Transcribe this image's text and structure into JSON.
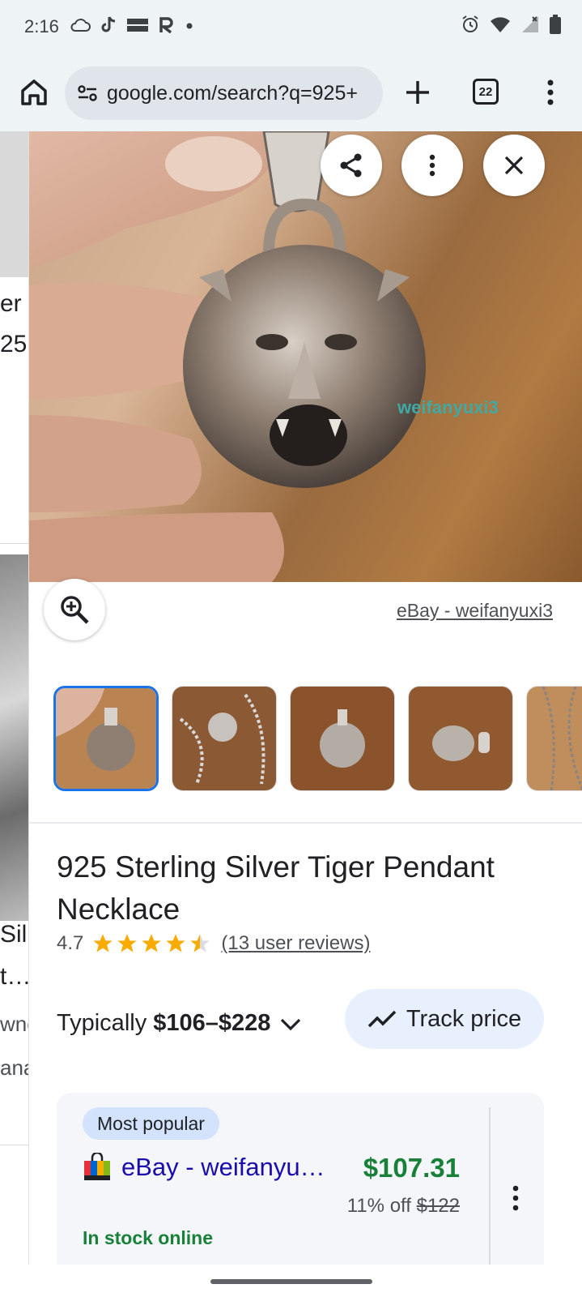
{
  "status_bar": {
    "time": "2:16",
    "left_icons": [
      "cloud-icon",
      "tiktok-icon",
      "temu-icon",
      "r-app-icon",
      "dot-icon"
    ],
    "right_icons": [
      "alarm-icon",
      "wifi-icon",
      "signal-icon",
      "battery-icon"
    ]
  },
  "browser": {
    "url": "google.com/search?q=925+",
    "tab_count": "22"
  },
  "left_column": {
    "fragments": [
      "er",
      "25",
      "Sil",
      "t…",
      "wne",
      "ana"
    ]
  },
  "panel": {
    "watermark": "weifanyuxi3",
    "source": "eBay - weifanyuxi3",
    "thumbnail_count": 5,
    "title": "925 Sterling Silver Tiger Pendant Necklace",
    "rating": "4.7",
    "rating_value": 4.7,
    "reviews": "(13 user reviews)",
    "price_prefix": "Typically",
    "price_range": "$106–$228",
    "track_price_label": "Track price",
    "offer": {
      "badge": "Most popular",
      "store": "eBay - weifanyu…",
      "price": "$107.31",
      "discount": "11% off",
      "original_price": "$122",
      "stock": "In stock online"
    }
  },
  "colors": {
    "accent_blue": "#1a73e8",
    "link_purple": "#1a0dab",
    "price_green": "#188038",
    "star_gold": "#f9ab00"
  }
}
